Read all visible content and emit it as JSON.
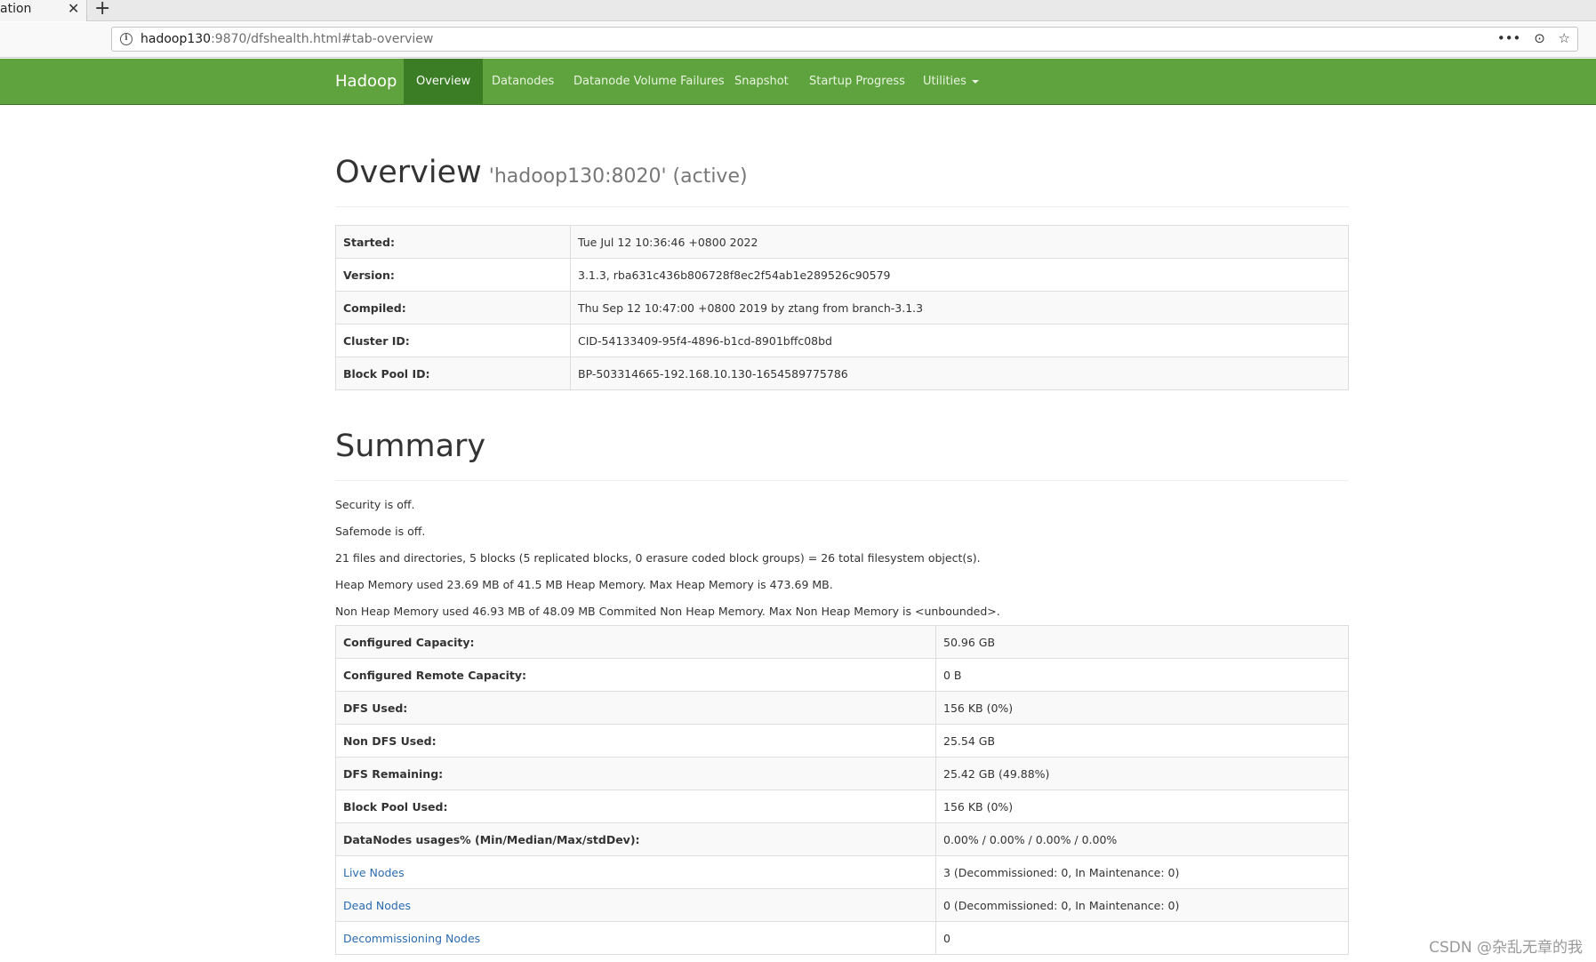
{
  "browser": {
    "tab_title": "ation",
    "tab_close": "✕",
    "new_tab": "+",
    "url_host": "hadoop130",
    "url_rest": ":9870/dfshealth.html#tab-overview",
    "url_info_icon": "i",
    "url_more": "•••",
    "url_pocket": "⊙",
    "url_star": "☆"
  },
  "navbar": {
    "brand": "Hadoop",
    "items": [
      {
        "label": "Overview",
        "active": true
      },
      {
        "label": "Datanodes"
      },
      {
        "label": "Datanode Volume Failures"
      },
      {
        "label": "Snapshot"
      },
      {
        "label": "Startup Progress"
      },
      {
        "label": "Utilities"
      }
    ],
    "color": "#5fa33e"
  },
  "overview": {
    "title": "Overview",
    "subtitle": "'hadoop130:8020' (active)",
    "rows": [
      {
        "label": "Started:",
        "value": "Tue Jul 12 10:36:46 +0800 2022"
      },
      {
        "label": "Version:",
        "value": "3.1.3, rba631c436b806728f8ec2f54ab1e289526c90579"
      },
      {
        "label": "Compiled:",
        "value": "Thu Sep 12 10:47:00 +0800 2019 by ztang from branch-3.1.3"
      },
      {
        "label": "Cluster ID:",
        "value": "CID-54133409-95f4-4896-b1cd-8901bffc08bd"
      },
      {
        "label": "Block Pool ID:",
        "value": "BP-503314665-192.168.10.130-1654589775786"
      }
    ]
  },
  "summary": {
    "title": "Summary",
    "lines": [
      "Security is off.",
      "Safemode is off.",
      "21 files and directories, 5 blocks (5 replicated blocks, 0 erasure coded block groups) = 26 total filesystem object(s).",
      "Heap Memory used 23.69 MB of 41.5 MB Heap Memory. Max Heap Memory is 473.69 MB.",
      "Non Heap Memory used 46.93 MB of 48.09 MB Commited Non Heap Memory. Max Non Heap Memory is <unbounded>."
    ],
    "rows": [
      {
        "label": "Configured Capacity:",
        "value": "50.96 GB"
      },
      {
        "label": "Configured Remote Capacity:",
        "value": "0 B"
      },
      {
        "label": "DFS Used:",
        "value": "156 KB (0%)"
      },
      {
        "label": "Non DFS Used:",
        "value": "25.54 GB"
      },
      {
        "label": "DFS Remaining:",
        "value": "25.42 GB (49.88%)"
      },
      {
        "label": "Block Pool Used:",
        "value": "156 KB (0%)"
      },
      {
        "label": "DataNodes usages% (Min/Median/Max/stdDev):",
        "value": "0.00% / 0.00% / 0.00% / 0.00%"
      },
      {
        "label": "Live Nodes",
        "value": "3 (Decommissioned: 0, In Maintenance: 0)"
      },
      {
        "label": "Dead Nodes",
        "value": "0 (Decommissioned: 0, In Maintenance: 0)"
      },
      {
        "label": "Decommissioning Nodes",
        "value": "0"
      }
    ]
  },
  "watermark": "CSDN @杂乱无章的我"
}
